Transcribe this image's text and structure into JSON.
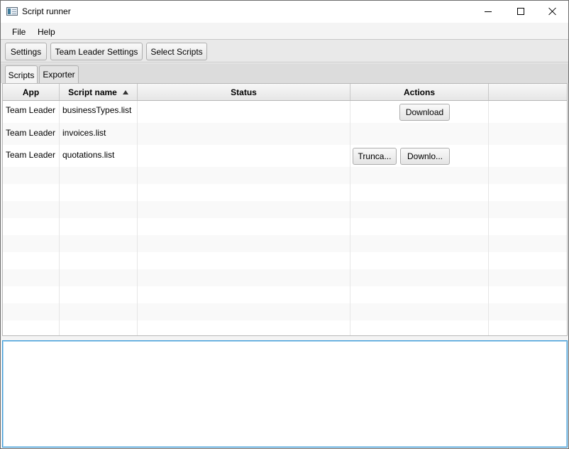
{
  "window": {
    "title": "Script runner"
  },
  "menu": {
    "file": "File",
    "help": "Help"
  },
  "toolbar": {
    "settings": "Settings",
    "team_leader_settings": "Team Leader Settings",
    "select_scripts": "Select Scripts"
  },
  "tabs": {
    "scripts": "Scripts",
    "exporter": "Exporter"
  },
  "table": {
    "columns": {
      "app": "App",
      "script_name": "Script name",
      "status": "Status",
      "actions": "Actions"
    },
    "rows": [
      {
        "app": "Team Leader",
        "script_name": "businessTypes.list",
        "status": "",
        "actions": [
          "Download"
        ]
      },
      {
        "app": "Team Leader",
        "script_name": "invoices.list",
        "status": "",
        "actions": []
      },
      {
        "app": "Team Leader",
        "script_name": "quotations.list",
        "status": "",
        "actions": [
          "Trunca...",
          "Downlo..."
        ]
      }
    ]
  },
  "console": {
    "value": ""
  }
}
